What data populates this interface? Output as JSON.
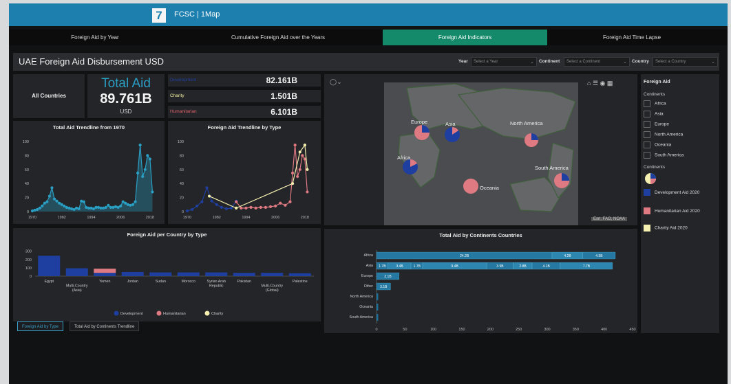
{
  "app": {
    "logo": "7",
    "title": "FCSC | 1Map"
  },
  "nav": {
    "tabs": [
      {
        "label": "Foreign Aid by Year"
      },
      {
        "label": "Cumulative Foreign Aid over the Years"
      },
      {
        "label": "Foreign Aid Indicators",
        "active": true
      },
      {
        "label": "Foreign Aid Time Lapse"
      }
    ]
  },
  "header": {
    "title": "UAE Foreign Aid Disbursement USD",
    "filters": [
      {
        "label": "Year",
        "placeholder": "Select a Year"
      },
      {
        "label": "Continent",
        "placeholder": "Select a Continent"
      },
      {
        "label": "Country",
        "placeholder": "Select a Country"
      }
    ]
  },
  "kpi": {
    "scope": "All Countries",
    "total_label": "Total Aid",
    "total_value": "89.761B",
    "total_unit": "USD",
    "breakdown": [
      {
        "label": "Development",
        "value": "82.161B",
        "color": "#1f3fa0"
      },
      {
        "label": "Charity",
        "value": "1.501B",
        "color": "#f2efa0"
      },
      {
        "label": "Humanitarian",
        "value": "6.101B",
        "color": "#e0606a"
      }
    ]
  },
  "colors": {
    "teal": "#2a9fc4",
    "dev": "#1f3fa0",
    "hum": "#e07a82",
    "cha": "#f6f0b0"
  },
  "chart_data": [
    {
      "type": "area",
      "title": "Total Aid Trendline from 1970",
      "x_ticks": [
        "1970",
        "1982",
        "1994",
        "2006",
        "2018"
      ],
      "y_ticks": [
        0,
        20,
        40,
        60,
        80,
        100
      ],
      "ylim": [
        0,
        100
      ],
      "xlim": [
        1970,
        2020
      ],
      "series": [
        {
          "x": [
            1970,
            1971,
            1972,
            1973,
            1974,
            1975,
            1976,
            1977,
            1978,
            1979,
            1980,
            1981,
            1982,
            1983,
            1984,
            1985,
            1986,
            1987,
            1988,
            1989,
            1990,
            1991,
            1992,
            1993,
            1994,
            1995,
            1996,
            1997,
            1998,
            1999,
            2000,
            2001,
            2002,
            2003,
            2004,
            2005,
            2006,
            2007,
            2008,
            2009,
            2010,
            2011,
            2012,
            2013,
            2014,
            2015,
            2016,
            2017,
            2018,
            2019
          ],
          "values": [
            1,
            2,
            3,
            5,
            8,
            12,
            14,
            22,
            34,
            18,
            15,
            12,
            10,
            8,
            6,
            5,
            4,
            3,
            5,
            4,
            15,
            14,
            6,
            5,
            5,
            4,
            6,
            6,
            5,
            5,
            6,
            9,
            6,
            6,
            7,
            6,
            8,
            14,
            12,
            10,
            9,
            10,
            14,
            55,
            95,
            50,
            60,
            80,
            75,
            28
          ]
        }
      ]
    },
    {
      "type": "line",
      "title": "Foreign Aid Trendline by Type",
      "x_ticks": [
        "1970",
        "1982",
        "1994",
        "2006",
        "2018"
      ],
      "y_ticks": [
        0,
        20,
        40,
        60,
        80,
        100
      ],
      "ylim": [
        0,
        100
      ],
      "xlim": [
        1970,
        2020
      ],
      "series": [
        {
          "name": "Development",
          "x": [
            1970,
            1972,
            1974,
            1976,
            1978,
            1980,
            1982,
            1984,
            1986,
            1988,
            1990
          ],
          "values": [
            1,
            3,
            8,
            14,
            34,
            15,
            10,
            6,
            4,
            5,
            15
          ]
        },
        {
          "name": "Humanitarian",
          "x": [
            1990,
            1992,
            1994,
            1996,
            1998,
            2000,
            2002,
            2004,
            2006,
            2008,
            2010,
            2012,
            2013,
            2014,
            2015,
            2016,
            2017,
            2018,
            2019
          ],
          "values": [
            14,
            5,
            5,
            6,
            5,
            6,
            6,
            7,
            8,
            12,
            9,
            14,
            55,
            95,
            50,
            60,
            80,
            75,
            28
          ]
        },
        {
          "name": "Charity",
          "x": [
            1979,
            1990,
            2013,
            2016,
            2018,
            2019
          ],
          "values": [
            22,
            5,
            40,
            85,
            95,
            60
          ]
        }
      ]
    },
    {
      "type": "bar",
      "title": "Foreign Aid per Country by Type",
      "categories": [
        "Egypt",
        "Multi-Country (Asia)",
        "Yemen",
        "Jordan",
        "Sudan",
        "Morocco",
        "Syrian Arab Republic",
        "Pakistan",
        "Multi-Country (Global)",
        "Palestine"
      ],
      "y_ticks": [
        0,
        100,
        200,
        300
      ],
      "ylim": [
        0,
        330
      ],
      "series": [
        {
          "name": "Development",
          "values": [
            245,
            95,
            40,
            50,
            45,
            45,
            45,
            40,
            40,
            35
          ]
        },
        {
          "name": "Humanitarian",
          "values": [
            0,
            0,
            50,
            0,
            0,
            0,
            0,
            0,
            0,
            0
          ]
        },
        {
          "name": "Charity",
          "values": [
            0,
            0,
            0,
            0,
            0,
            0,
            0,
            0,
            0,
            0
          ]
        }
      ],
      "legend": [
        "Development",
        "Humanitarian",
        "Charity"
      ]
    },
    {
      "type": "bar",
      "orientation": "horizontal-stacked",
      "title": "Total Aid by Continents Countries",
      "categories": [
        "Africa",
        "Asia",
        "Europe",
        "Other",
        "North America",
        "Oceania",
        "South America"
      ],
      "x_ticks": [
        0,
        50,
        100,
        150,
        200,
        250,
        300,
        350,
        400,
        450
      ],
      "xlim": [
        0,
        450
      ],
      "segments": [
        [
          {
            "v": 24.2,
            "label": "24.2B"
          },
          {
            "v": 4.2,
            "label": "4.2B"
          },
          {
            "v": 4.5,
            "label": "4.5B"
          }
        ],
        [
          {
            "v": 1.7,
            "label": "1.7B"
          },
          {
            "v": 3.4,
            "label": "3.4B"
          },
          {
            "v": 1.7,
            "label": "1.7B"
          },
          {
            "v": 9.4,
            "label": "9.4B"
          },
          {
            "v": 3.9,
            "label": "3.9B"
          },
          {
            "v": 2.8,
            "label": "2.8B"
          },
          {
            "v": 4.1,
            "label": "4.1B"
          },
          {
            "v": 7.7,
            "label": "7.7B"
          }
        ],
        [
          {
            "v": 2.1,
            "label": "2.1B"
          }
        ],
        [
          {
            "v": 3.1,
            "label": "3.1B"
          }
        ],
        [],
        [],
        []
      ],
      "bar_extent": [
        420,
        415,
        40,
        25,
        3,
        3,
        3
      ]
    }
  ],
  "map": {
    "attribution": "Esri, FAO, NOAA",
    "labels": [
      "Europe",
      "Asia",
      "North America",
      "Africa",
      "South America",
      "Oceania"
    ]
  },
  "legend_panel": {
    "title": "Foreign Aid",
    "continents_title": "Continents",
    "continents": [
      "Africa",
      "Asia",
      "Europe",
      "North America",
      "Oceania",
      "South America"
    ],
    "continents2_title": "Continents",
    "types": [
      {
        "label": "Development Aid 2020"
      },
      {
        "label": "Humanitarian Aid 2020"
      },
      {
        "label": "Charity Aid 2020"
      }
    ]
  },
  "bottom_tabs": [
    {
      "label": "Foreign Aid by Type",
      "active": true
    },
    {
      "label": "Total Aid by Continents Trendline"
    }
  ]
}
